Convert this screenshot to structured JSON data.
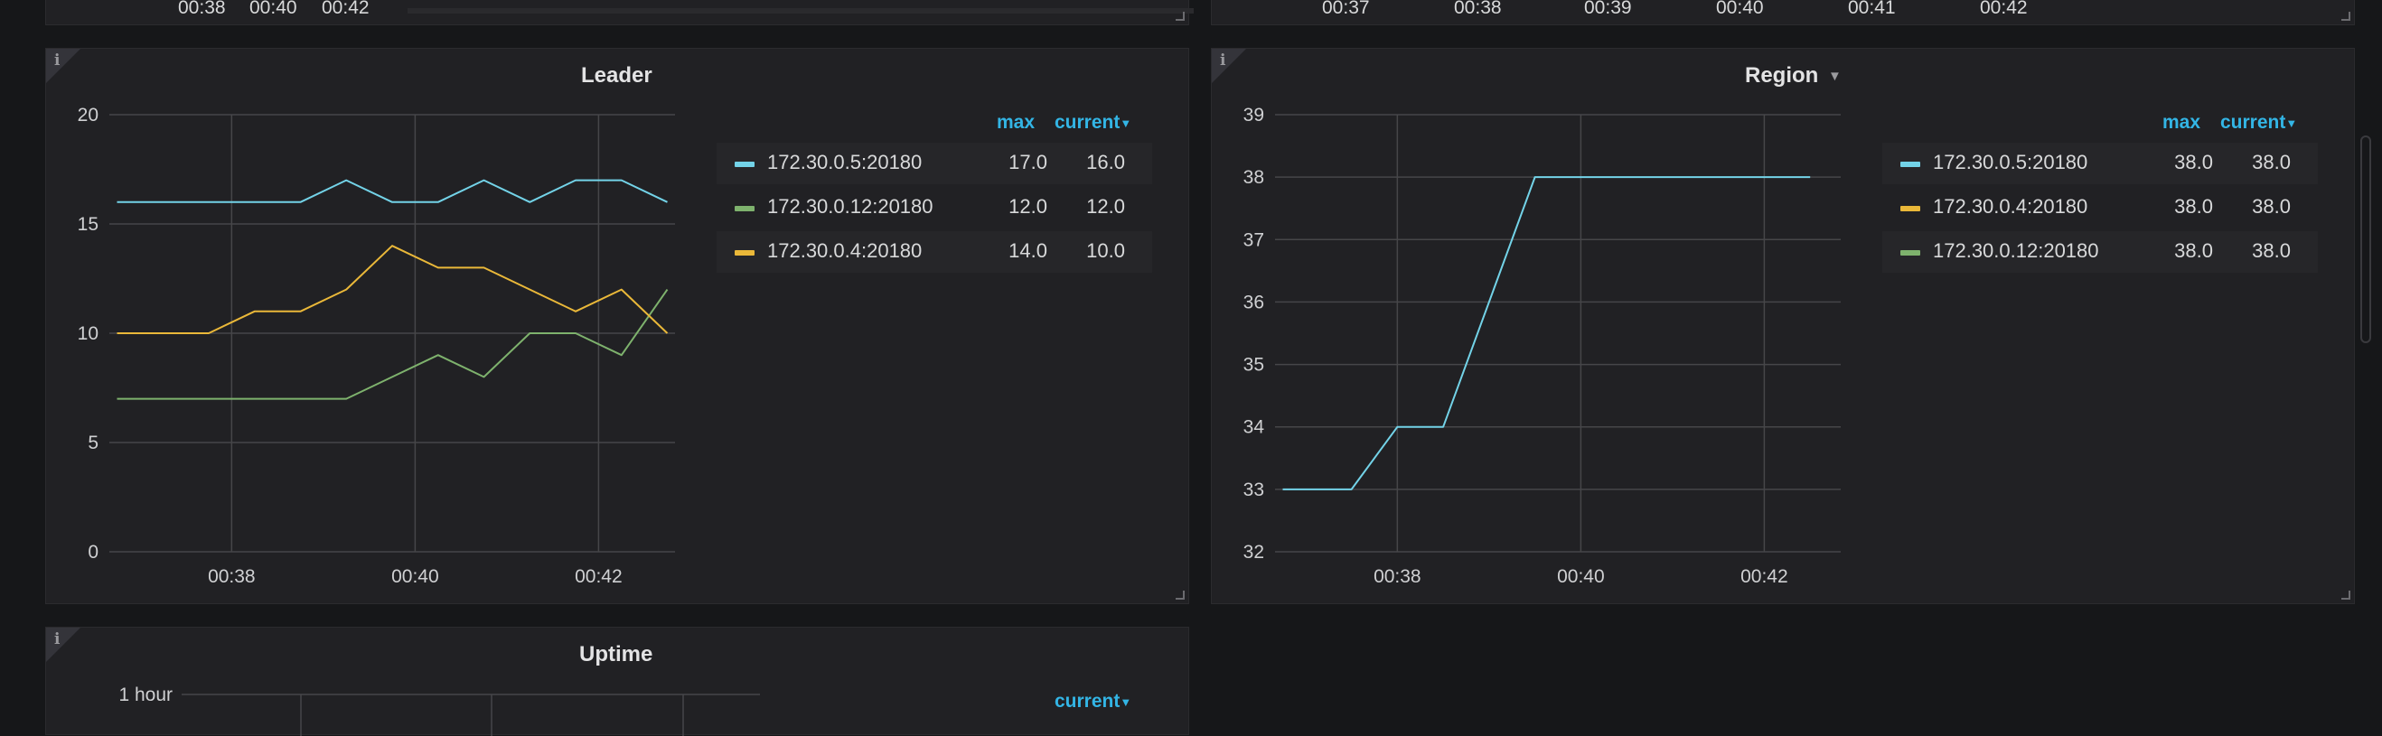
{
  "colors": {
    "background": "#161719",
    "panel": "#212124",
    "grid": "#464649",
    "accent": "#33b5e5",
    "series_blue": "#73d3e8",
    "series_green": "#7eb26d",
    "series_yellow": "#eab839"
  },
  "top_strip": {
    "left_ticks": [
      "00:38",
      "00:40",
      "00:42"
    ],
    "right_ticks": [
      "00:37",
      "00:38",
      "00:39",
      "00:40",
      "00:41",
      "00:42"
    ]
  },
  "leader": {
    "title": "Leader",
    "legend": {
      "col_max": "max",
      "col_current": "current",
      "rows": [
        {
          "name": "172.30.0.5:20180",
          "max": "17.0",
          "current": "16.0",
          "color": "#73d3e8"
        },
        {
          "name": "172.30.0.12:20180",
          "max": "12.0",
          "current": "12.0",
          "color": "#7eb26d"
        },
        {
          "name": "172.30.0.4:20180",
          "max": "14.0",
          "current": "10.0",
          "color": "#eab839"
        }
      ]
    }
  },
  "region": {
    "title": "Region",
    "legend": {
      "col_max": "max",
      "col_current": "current",
      "rows": [
        {
          "name": "172.30.0.5:20180",
          "max": "38.0",
          "current": "38.0",
          "color": "#73d3e8"
        },
        {
          "name": "172.30.0.4:20180",
          "max": "38.0",
          "current": "38.0",
          "color": "#eab839"
        },
        {
          "name": "172.30.0.12:20180",
          "max": "38.0",
          "current": "38.0",
          "color": "#7eb26d"
        }
      ]
    }
  },
  "uptime": {
    "title": "Uptime",
    "y_tick": "1 hour",
    "legend_col_current": "current"
  },
  "chart_data": [
    {
      "type": "line",
      "title": "Leader",
      "x_ticks": [
        "00:38",
        "00:40",
        "00:42"
      ],
      "y_ticks": [
        "0",
        "5",
        "10",
        "15",
        "20"
      ],
      "ylim": [
        0,
        20
      ],
      "x": [
        "00:36:45",
        "00:37:15",
        "00:37:45",
        "00:38:15",
        "00:38:45",
        "00:39:15",
        "00:39:45",
        "00:40:15",
        "00:40:45",
        "00:41:15",
        "00:41:45",
        "00:42:15",
        "00:42:45"
      ],
      "series": [
        {
          "name": "172.30.0.5:20180",
          "color": "#73d3e8",
          "values": [
            16,
            16,
            16,
            16,
            16,
            17,
            16,
            16,
            17,
            16,
            17,
            17,
            16
          ]
        },
        {
          "name": "172.30.0.12:20180",
          "color": "#7eb26d",
          "values": [
            7,
            7,
            7,
            7,
            7,
            7,
            8,
            9,
            8,
            10,
            10,
            9,
            12
          ]
        },
        {
          "name": "172.30.0.4:20180",
          "color": "#eab839",
          "values": [
            10,
            10,
            10,
            11,
            11,
            12,
            14,
            13,
            13,
            12,
            11,
            12,
            10
          ]
        }
      ],
      "grid": true,
      "legend": "right"
    },
    {
      "type": "line",
      "title": "Region",
      "x_ticks": [
        "00:38",
        "00:40",
        "00:42"
      ],
      "y_ticks": [
        "32",
        "33",
        "34",
        "35",
        "36",
        "37",
        "38",
        "39"
      ],
      "ylim": [
        32,
        39
      ],
      "x": [
        "00:36:45",
        "00:37:30",
        "00:38:00",
        "00:38:30",
        "00:39:30",
        "00:40:00",
        "00:42:30"
      ],
      "series": [
        {
          "name": "172.30.0.5:20180",
          "color": "#73d3e8",
          "values": [
            33,
            33,
            34,
            34,
            38,
            38,
            38
          ]
        }
      ],
      "grid": true,
      "legend": "right"
    }
  ]
}
